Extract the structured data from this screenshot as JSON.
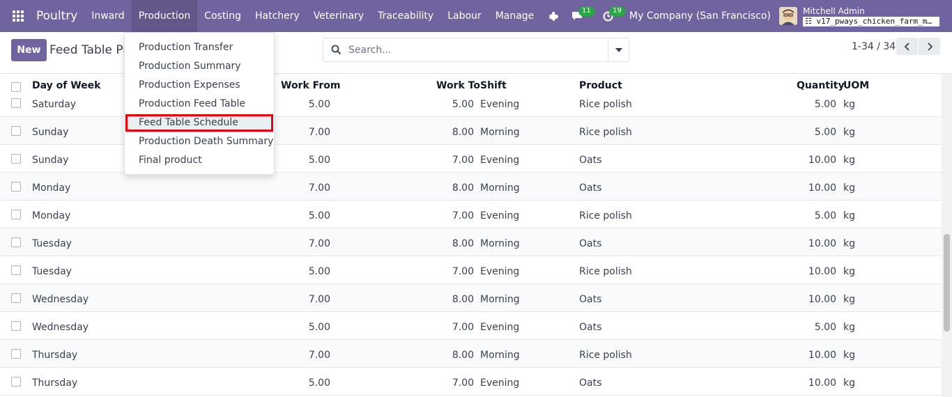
{
  "navbar": {
    "brand": "Poultry",
    "menus": [
      "Inward",
      "Production",
      "Costing",
      "Hatchery",
      "Veterinary",
      "Traceability",
      "Labour",
      "Manage"
    ],
    "active_menu": "Production",
    "plus": "+",
    "activity_badge": "11",
    "messages_badge": "19",
    "company": "My Company (San Francisco)",
    "user_name": "Mitchell Admin",
    "db_name": "v17_pways_chicken_farm_m…",
    "colors": {
      "navbar": "#71639e",
      "badge": "#28a745"
    }
  },
  "control": {
    "new_label": "New",
    "breadcrumb": "Feed Table Pro",
    "search_placeholder": "Search...",
    "pager": "1-34 / 34"
  },
  "dropdown": {
    "items": [
      "Production Transfer",
      "Production Summary",
      "Production Expenses",
      "Production Feed Table",
      "Feed Table Schedule",
      "Production Death Summary",
      "Final product"
    ],
    "highlighted": "Feed Table Schedule",
    "highlight_color": "#e3000f"
  },
  "table": {
    "columns": [
      "Day of Week",
      "Work From",
      "Work To",
      "Shift",
      "Product",
      "Quantity",
      "UOM"
    ],
    "rows": [
      {
        "day": "Saturday",
        "from": "5.00",
        "to": "5.00",
        "shift": "Evening",
        "product": "Rice polish",
        "qty": "5.00",
        "uom": "kg"
      },
      {
        "day": "Sunday",
        "from": "7.00",
        "to": "8.00",
        "shift": "Morning",
        "product": "Rice polish",
        "qty": "5.00",
        "uom": "kg"
      },
      {
        "day": "Sunday",
        "from": "5.00",
        "to": "7.00",
        "shift": "Evening",
        "product": "Oats",
        "qty": "10.00",
        "uom": "kg"
      },
      {
        "day": "Monday",
        "from": "7.00",
        "to": "8.00",
        "shift": "Morning",
        "product": "Oats",
        "qty": "10.00",
        "uom": "kg"
      },
      {
        "day": "Monday",
        "from": "5.00",
        "to": "7.00",
        "shift": "Evening",
        "product": "Rice polish",
        "qty": "5.00",
        "uom": "kg"
      },
      {
        "day": "Tuesday",
        "from": "7.00",
        "to": "8.00",
        "shift": "Morning",
        "product": "Oats",
        "qty": "10.00",
        "uom": "kg"
      },
      {
        "day": "Tuesday",
        "from": "5.00",
        "to": "7.00",
        "shift": "Evening",
        "product": "Rice polish",
        "qty": "10.00",
        "uom": "kg"
      },
      {
        "day": "Wednesday",
        "from": "7.00",
        "to": "8.00",
        "shift": "Morning",
        "product": "Oats",
        "qty": "10.00",
        "uom": "kg"
      },
      {
        "day": "Wednesday",
        "from": "5.00",
        "to": "7.00",
        "shift": "Evening",
        "product": "Oats",
        "qty": "5.00",
        "uom": "kg"
      },
      {
        "day": "Thursday",
        "from": "7.00",
        "to": "8.00",
        "shift": "Morning",
        "product": "Rice polish",
        "qty": "10.00",
        "uom": "kg"
      },
      {
        "day": "Thursday",
        "from": "5.00",
        "to": "7.00",
        "shift": "Evening",
        "product": "Oats",
        "qty": "10.00",
        "uom": "kg"
      }
    ]
  }
}
